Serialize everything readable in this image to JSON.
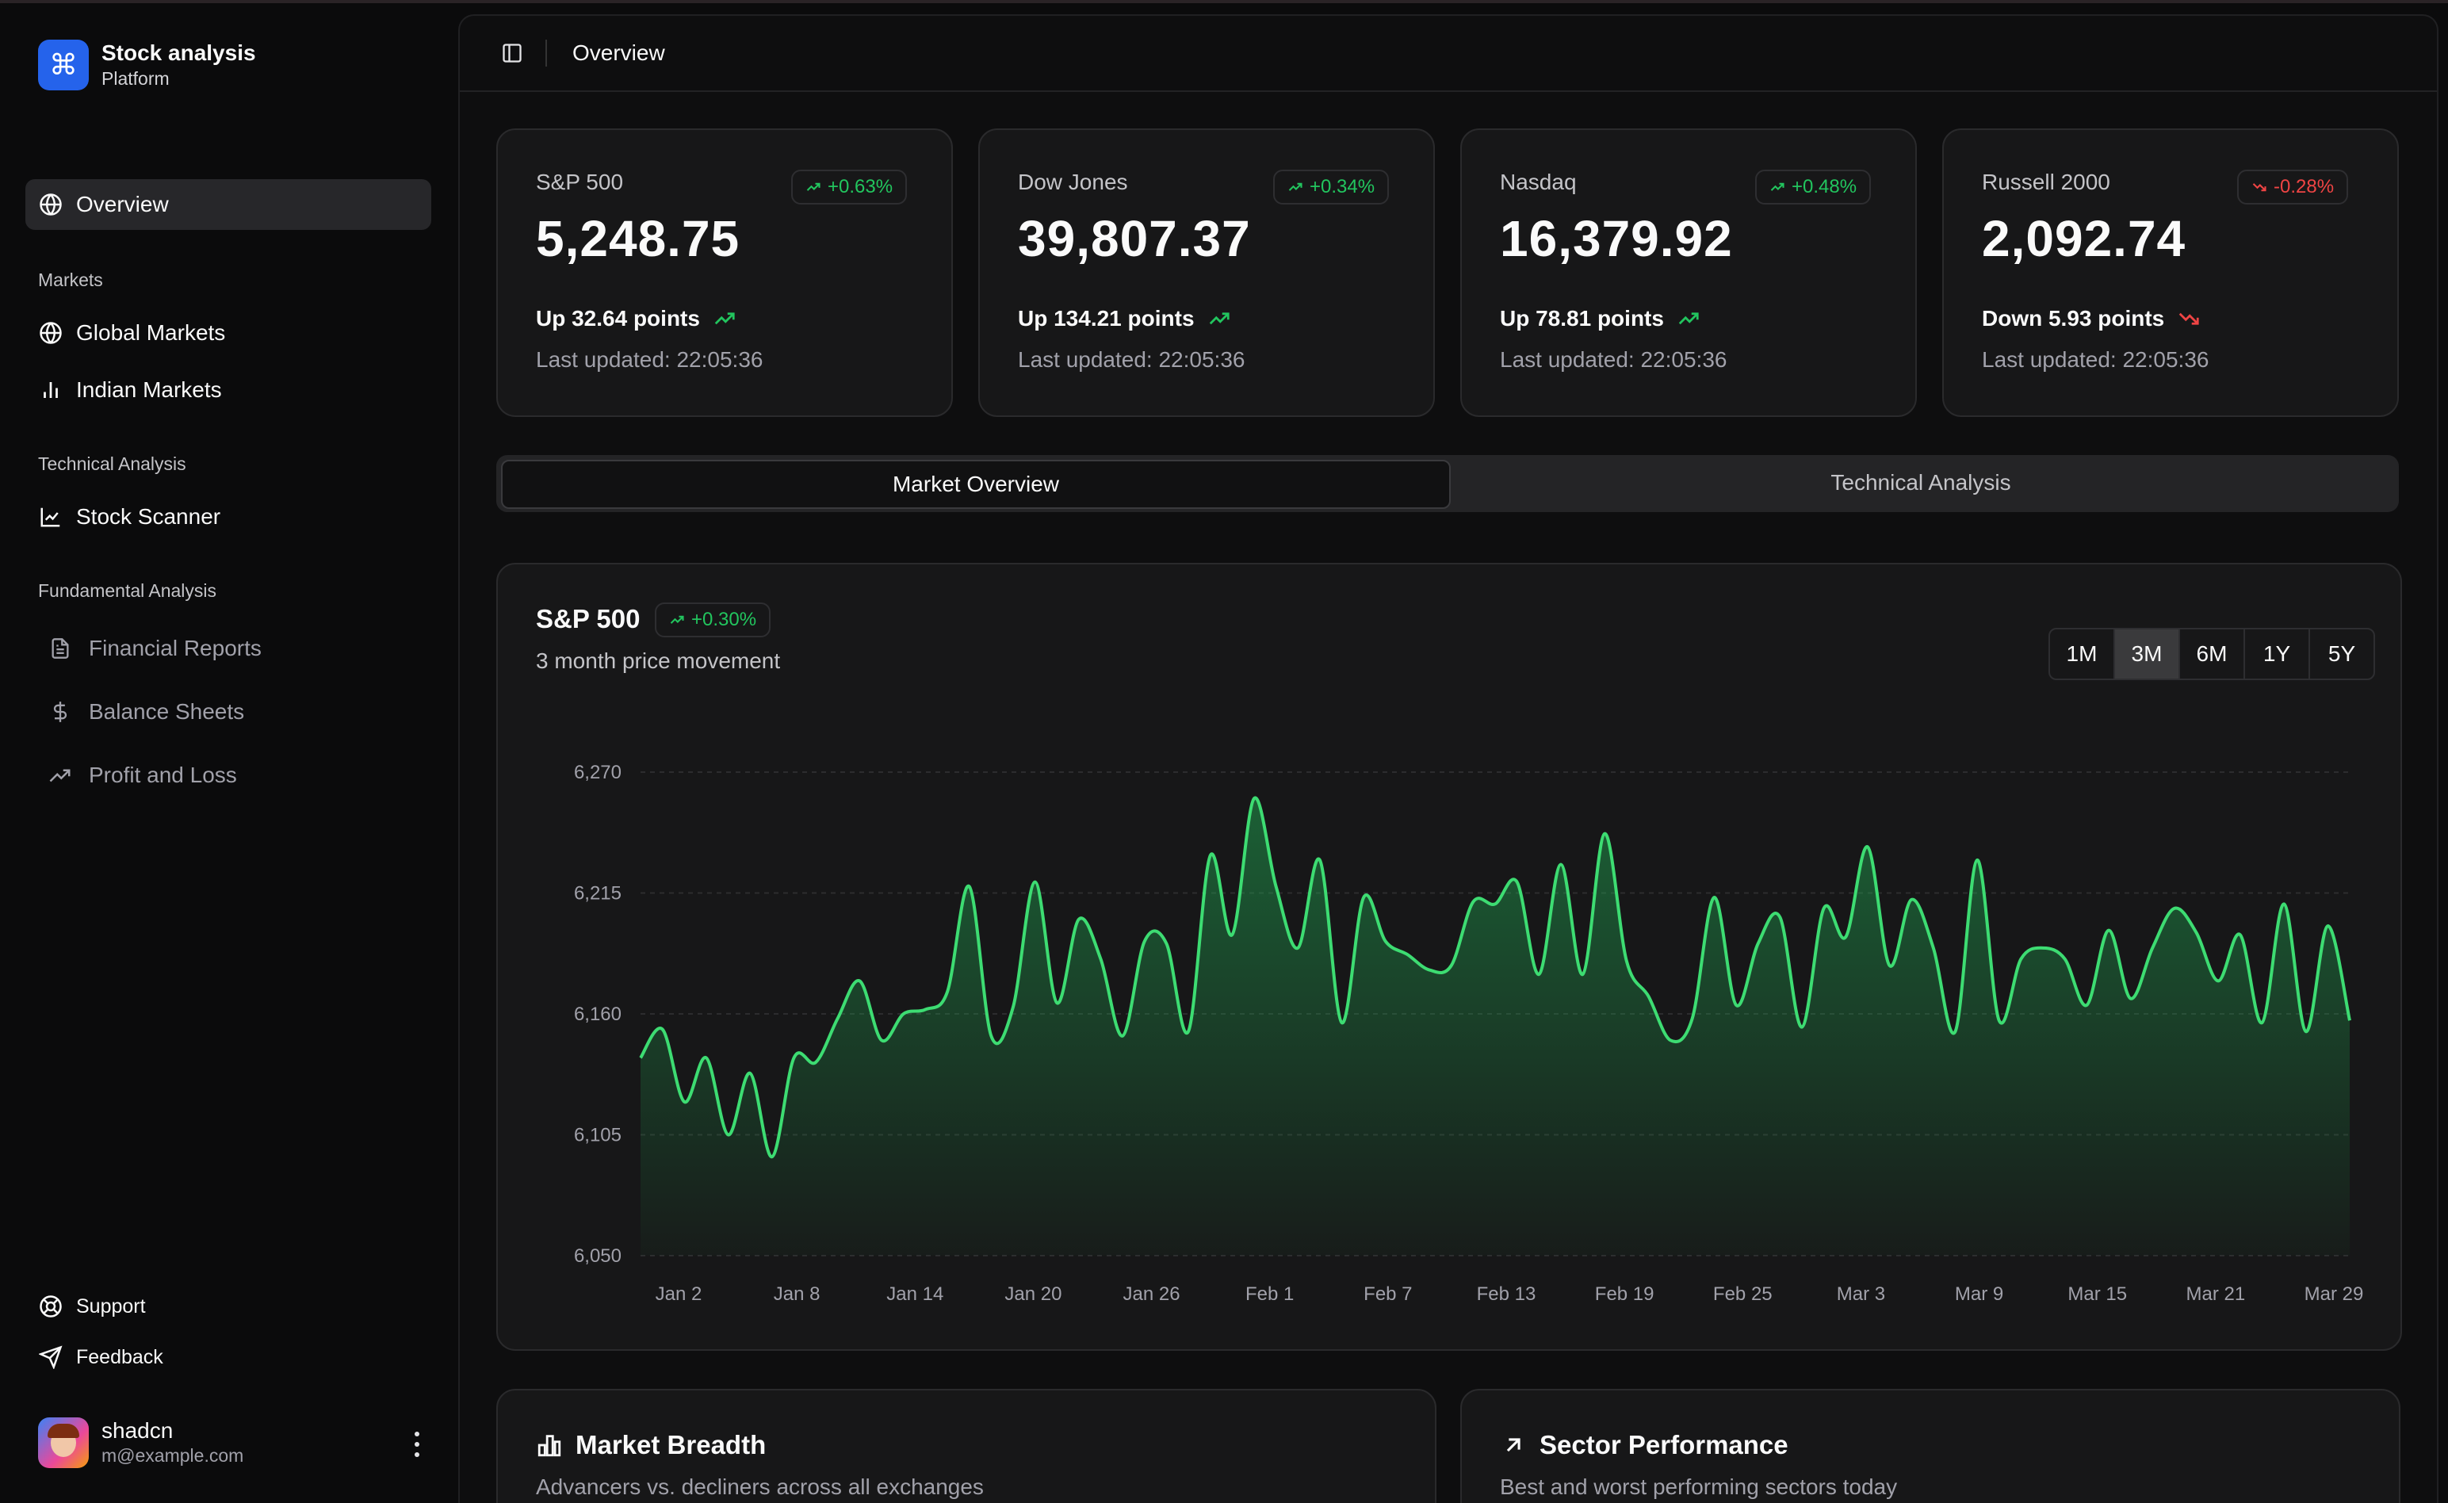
{
  "app": {
    "title": "Stock analysis",
    "subtitle": "Platform"
  },
  "sidebar": {
    "overview": "Overview",
    "sections": [
      {
        "label": "Markets",
        "items": [
          "Global Markets",
          "Indian Markets"
        ]
      },
      {
        "label": "Technical Analysis",
        "items": [
          "Stock Scanner"
        ]
      },
      {
        "label": "Fundamental Analysis",
        "items": [
          "Financial Reports",
          "Balance Sheets",
          "Profit and Loss"
        ]
      }
    ],
    "footer": [
      "Support",
      "Feedback"
    ],
    "user": {
      "name": "shadcn",
      "email": "m@example.com"
    }
  },
  "header": {
    "title": "Overview"
  },
  "stats": [
    {
      "name": "S&P 500",
      "value": "5,248.75",
      "badge": "+0.63%",
      "direction": "up",
      "change": "Up 32.64 points",
      "updated": "Last updated: 22:05:36"
    },
    {
      "name": "Dow Jones",
      "value": "39,807.37",
      "badge": "+0.34%",
      "direction": "up",
      "change": "Up 134.21 points",
      "updated": "Last updated: 22:05:36"
    },
    {
      "name": "Nasdaq",
      "value": "16,379.92",
      "badge": "+0.48%",
      "direction": "up",
      "change": "Up 78.81 points",
      "updated": "Last updated: 22:05:36"
    },
    {
      "name": "Russell 2000",
      "value": "2,092.74",
      "badge": "-0.28%",
      "direction": "down",
      "change": "Down 5.93 points",
      "updated": "Last updated: 22:05:36"
    }
  ],
  "tabs": [
    "Market Overview",
    "Technical Analysis"
  ],
  "chart_card": {
    "title": "S&P 500",
    "badge": "+0.30%",
    "subtitle": "3 month price movement",
    "ranges": [
      "1M",
      "3M",
      "6M",
      "1Y",
      "5Y"
    ],
    "selected_range": "3M"
  },
  "bottom_cards": [
    {
      "title": "Market Breadth",
      "subtitle": "Advancers vs. decliners across all exchanges"
    },
    {
      "title": "Sector Performance",
      "subtitle": "Best and worst performing sectors today"
    }
  ],
  "colors": {
    "accent": "#2563eb",
    "up": "#22c55e",
    "down": "#ef4444",
    "line": "#3ddc72"
  },
  "chart_data": {
    "type": "area",
    "title": "S&P 500",
    "y_ticks": [
      6050,
      6105,
      6160,
      6215,
      6270
    ],
    "ylim": [
      6050,
      6270
    ],
    "x_ticks": [
      "Jan 2",
      "Jan 8",
      "Jan 14",
      "Jan 20",
      "Jan 26",
      "Feb 1",
      "Feb 7",
      "Feb 13",
      "Feb 19",
      "Feb 25",
      "Mar 3",
      "Mar 9",
      "Mar 15",
      "Mar 21",
      "Mar 29"
    ],
    "grid": true,
    "series": [
      {
        "x_start_day": 0,
        "values": [
          6140,
          6153,
          6120,
          6140,
          6105,
          6133,
          6095,
          6140,
          6138,
          6158,
          6175,
          6148,
          6160,
          6162,
          6170,
          6218,
          6150,
          6163,
          6220,
          6165,
          6203,
          6185,
          6150,
          6193,
          6192,
          6152,
          6232,
          6196,
          6258,
          6218,
          6190,
          6230,
          6156,
          6213,
          6193,
          6187,
          6180,
          6182,
          6211,
          6210,
          6220,
          6178,
          6228,
          6178,
          6242,
          6184,
          6168,
          6148,
          6158,
          6213,
          6164,
          6192,
          6204,
          6154,
          6208,
          6195,
          6236,
          6182,
          6212,
          6190,
          6152,
          6230,
          6157,
          6185,
          6190,
          6185,
          6164,
          6198,
          6167,
          6190,
          6208,
          6197,
          6175,
          6196,
          6156,
          6210,
          6152,
          6200,
          6157
        ]
      }
    ]
  }
}
